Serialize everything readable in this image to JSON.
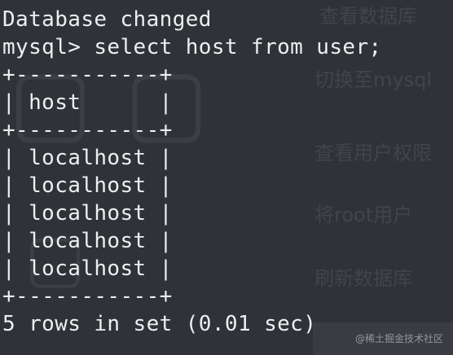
{
  "terminal": {
    "lines": [
      "Database changed",
      "mysql> select host from user;",
      "+-----------+",
      "| host      |",
      "+-----------+",
      "| localhost |",
      "| localhost |",
      "| localhost |",
      "| localhost |",
      "| localhost |",
      "+-----------+",
      "5 rows in set (0.01 sec)"
    ]
  },
  "background": {
    "steps": [
      "查看数据库",
      "切换至mysql",
      "查看用户权限",
      "将root用户",
      "刷新数据库"
    ]
  },
  "watermark": "@稀土掘金技术社区",
  "colors": {
    "background": "#2f3338",
    "text": "#eceef0"
  }
}
